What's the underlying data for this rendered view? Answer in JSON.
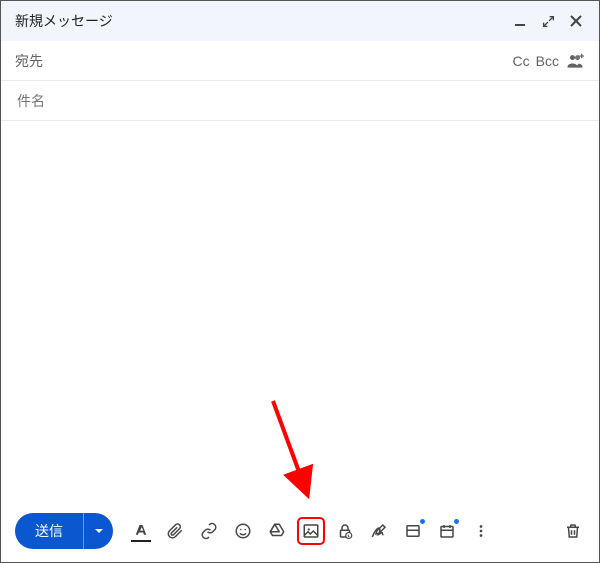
{
  "header": {
    "title": "新規メッセージ"
  },
  "recipients": {
    "to_label": "宛先",
    "cc_label": "Cc",
    "bcc_label": "Bcc"
  },
  "subject": {
    "placeholder": "件名"
  },
  "toolbar": {
    "send_label": "送信"
  },
  "icons": {
    "minimize": "minimize",
    "popout": "popout",
    "close": "close",
    "add_recipients": "add-recipients",
    "formatting": "formatting",
    "attach": "attach",
    "link": "link",
    "emoji": "emoji",
    "drive": "drive",
    "image": "image",
    "confidential": "confidential",
    "signature": "signature",
    "layout": "layout",
    "schedule": "schedule",
    "more": "more",
    "trash": "trash"
  }
}
